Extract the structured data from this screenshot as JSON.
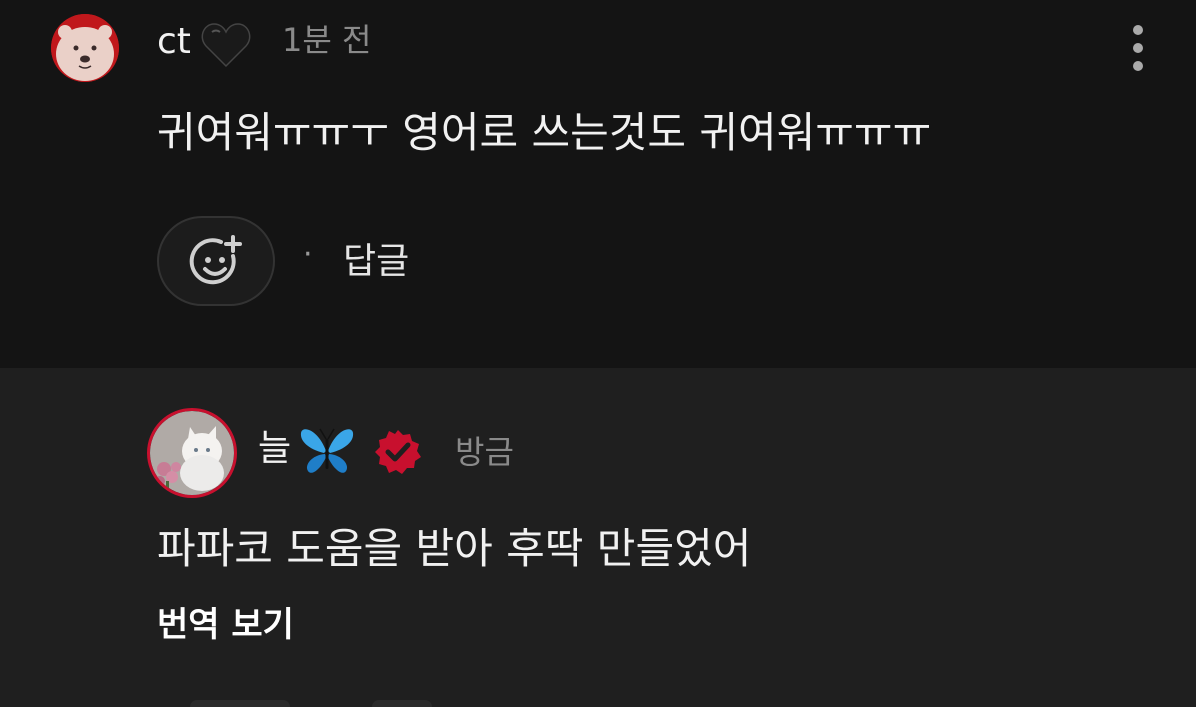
{
  "comments": [
    {
      "username": "ct",
      "username_emoji": "black-heart-icon",
      "timestamp": "1분 전",
      "text": "귀여워ㅠㅠㅜ 영어로 쓰는것도 귀여워ㅠㅠㅠ",
      "avatar": "polar-bear-avatar",
      "actions": {
        "react_icon": "add-reaction-icon",
        "separator": "·",
        "reply_label": "답글"
      },
      "menu_icon": "more-vertical-icon"
    },
    {
      "username": "늘",
      "username_emoji": "butterfly-icon",
      "verified_icon": "verified-badge-icon",
      "verified_color": "#c8102e",
      "timestamp": "방금",
      "text": "파파코 도움을 받아 후딱 만들었어",
      "avatar": "white-cat-avatar",
      "translate_label": "번역 보기"
    }
  ],
  "colors": {
    "background_top": "#141414",
    "background_reply": "#1f1f1f",
    "text_primary": "#f1f1f1",
    "text_secondary": "#8a8a8a",
    "accent_red": "#c8102e"
  }
}
